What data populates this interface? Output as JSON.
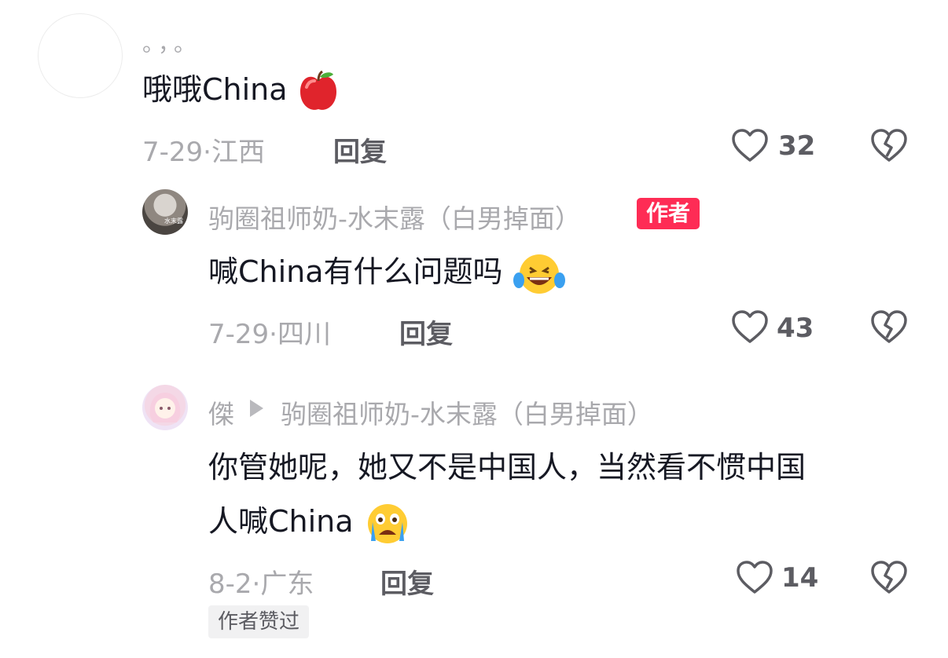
{
  "comments": [
    {
      "username": "。，。",
      "text": "哦哦China",
      "emoji": "red-apple-emoji",
      "date": "7-29",
      "separator": "·",
      "location": "江西",
      "reply_label": "回复",
      "likes": "32"
    },
    {
      "username": "驹圈祖师奶-水末露（白男掉面）",
      "badge": "作者",
      "text": "喊China有什么问题吗",
      "emoji": "laughing-tears-emoji",
      "date": "7-29",
      "separator": "·",
      "location": "四川",
      "reply_label": "回复",
      "likes": "43",
      "avatar_text": "水末露"
    },
    {
      "username": "傑",
      "reply_to": "驹圈祖师奶-水末露（白男掉面）",
      "text_line1": "你管她呢，她又不是中国人，当然看不惯中国",
      "text_line2": "人喊China",
      "emoji": "crying-emoji",
      "date": "8-2",
      "separator": "·",
      "location": "广东",
      "reply_label": "回复",
      "likes": "14",
      "author_liked_label": "作者赞过"
    }
  ],
  "colors": {
    "primary_text": "#161823",
    "secondary_text": "#a9a9ad",
    "action_text": "#5c5c62",
    "author_badge": "#fe2c55",
    "liked_badge_bg": "#f1f1f2"
  }
}
